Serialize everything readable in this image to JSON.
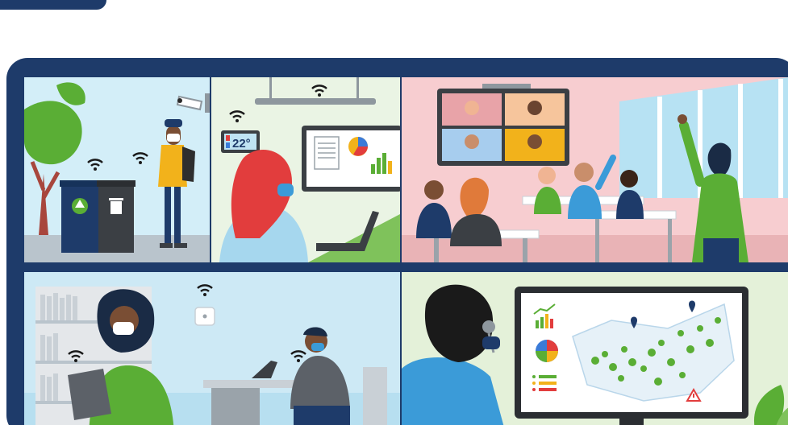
{
  "scenes": {
    "thermostat": {
      "temperature": "22°"
    }
  },
  "colors": {
    "frame": "#1e3b6a",
    "outdoor_sky": "#d3eef8",
    "office_wall": "#eaf4e4",
    "classroom_wall": "#f7cdd0",
    "library_wall": "#cde9f5",
    "monitoring_wall": "#e4f1d9",
    "accent_green": "#5aae35",
    "accent_red": "#e23d3d",
    "accent_blue": "#3b7bd8"
  }
}
